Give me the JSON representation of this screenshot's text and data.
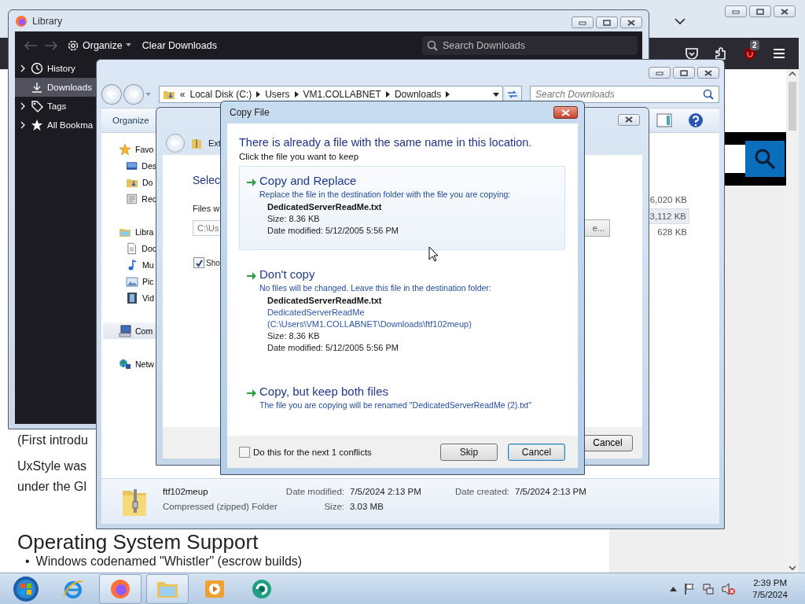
{
  "browser": {
    "toolbar": {
      "badge": "2"
    },
    "page": {
      "lines": [
        "(First introdu",
        "UxStyle was",
        "under the Gl"
      ],
      "heading": "Operating System Support",
      "bullets": [
        {
          "marker": "•",
          "text": "Windows codenamed \"Whistler\" (escrow builds)"
        }
      ]
    }
  },
  "library": {
    "title": "Library",
    "toolbar": {
      "organize": "Organize",
      "clear": "Clear Downloads",
      "search_placeholder": "Search Downloads"
    },
    "sidebar": [
      {
        "label": "History",
        "kind": "history",
        "expandable": true,
        "selected": false
      },
      {
        "label": "Downloads",
        "kind": "downloads",
        "expandable": false,
        "selected": true
      },
      {
        "label": "Tags",
        "kind": "tags",
        "expandable": true,
        "selected": false
      },
      {
        "label": "All Bookma",
        "kind": "bookmarks",
        "expandable": true,
        "selected": false
      }
    ]
  },
  "explorer": {
    "address": {
      "overflow": "«",
      "crumbs": [
        "Local Disk (C:)",
        "Users",
        "VM1.COLLABNET",
        "Downloads"
      ]
    },
    "search": {
      "placeholder": "Search Downloads"
    },
    "toolbar": {
      "organize": "Organize"
    },
    "nav": [
      {
        "label": "Favo",
        "kind": "favorites",
        "selected": false,
        "children": [
          {
            "label": "Des",
            "kind": "desktop",
            "selected": false
          },
          {
            "label": "Do",
            "kind": "downloads",
            "selected": false
          },
          {
            "label": "Rec",
            "kind": "recent",
            "selected": false
          }
        ]
      },
      {
        "label": "Libra",
        "kind": "libraries",
        "selected": false,
        "children": [
          {
            "label": "Doc",
            "kind": "documents",
            "selected": false
          },
          {
            "label": "Mu",
            "kind": "music",
            "selected": false
          },
          {
            "label": "Pic",
            "kind": "pictures",
            "selected": false
          },
          {
            "label": "Vid",
            "kind": "videos",
            "selected": false
          }
        ]
      },
      {
        "label": "Com",
        "kind": "computer",
        "selected": true
      },
      {
        "label": "Netw",
        "kind": "network",
        "selected": false
      }
    ],
    "sizes": [
      {
        "text": "6,020 KB",
        "selected": false
      },
      {
        "text": "3,112 KB",
        "selected": true
      },
      {
        "text": "628 KB",
        "selected": false
      }
    ],
    "details": {
      "name": "ftf102meup",
      "type": "Compressed (zipped) Folder",
      "fields": [
        {
          "label": "Date modified:",
          "value": "7/5/2024 2:13 PM"
        },
        {
          "label": "Size:",
          "value": "3.03 MB"
        },
        {
          "label": "Date created:",
          "value": "7/5/2024 2:13 PM"
        }
      ]
    }
  },
  "wizard": {
    "title": "Ext",
    "heading": "Selec",
    "files_label": "Files w",
    "path_value": "C:\\Us",
    "browse": "e...",
    "show_checkbox": {
      "label": "Sho",
      "checked": true
    },
    "cancel": "Cancel"
  },
  "dialog": {
    "title": "Copy File",
    "heading": "There is already a file with the same name in this location.",
    "subheading": "Click the file you want to keep",
    "options": [
      {
        "title": "Copy and Replace",
        "description": "Replace the file in the destination folder with the file you are copying:",
        "highlighted": true,
        "details": [
          {
            "kind": "name",
            "text": "DedicatedServerReadMe.txt"
          },
          {
            "kind": "info",
            "text": "Size: 8.36 KB"
          },
          {
            "kind": "info",
            "text": "Date modified: 5/12/2005 5:56 PM"
          }
        ]
      },
      {
        "title": "Don't copy",
        "description": "No files will be changed. Leave this file in the destination folder:",
        "highlighted": false,
        "details": [
          {
            "kind": "name",
            "text": "DedicatedServerReadMe.txt"
          },
          {
            "kind": "location",
            "text": "DedicatedServerReadMe"
          },
          {
            "kind": "location",
            "text": "(C:\\Users\\VM1.COLLABNET\\Downloads\\ftf102meup)"
          },
          {
            "kind": "info",
            "text": "Size: 8.36 KB"
          },
          {
            "kind": "info",
            "text": "Date modified: 5/12/2005 5:56 PM"
          }
        ]
      },
      {
        "title": "Copy, but keep both files",
        "description": "The file you are copying will be renamed \"DedicatedServerReadMe (2).txt\"",
        "highlighted": false
      }
    ],
    "apply_all": {
      "label": "Do this for the next 1 conflicts",
      "checked": false
    },
    "buttons": [
      {
        "label": "Skip",
        "focused": false
      },
      {
        "label": "Cancel",
        "focused": true
      }
    ]
  },
  "taskbar": {
    "apps": [
      {
        "kind": "ie",
        "active": false
      },
      {
        "kind": "firefox",
        "active": true
      },
      {
        "kind": "explorer",
        "active": true
      },
      {
        "kind": "media",
        "active": false
      },
      {
        "kind": "app",
        "active": false
      }
    ],
    "clock": {
      "time": "2:39 PM",
      "date": "7/5/2024"
    }
  }
}
